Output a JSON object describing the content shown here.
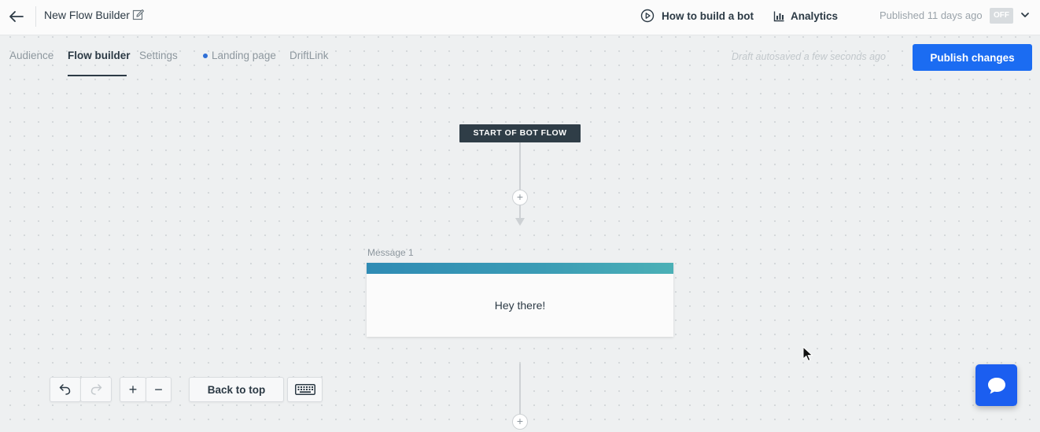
{
  "header": {
    "title": "New Flow Builder",
    "howto_label": "How to build a bot",
    "analytics_label": "Analytics",
    "published_text": "Published 11 days ago",
    "toggle_label": "OFF"
  },
  "tabs": [
    {
      "label": "Audience",
      "active": false
    },
    {
      "label": "Flow builder",
      "active": true
    },
    {
      "label": "Settings",
      "active": false
    },
    {
      "label": "Landing page",
      "active": false
    },
    {
      "label": "DriftLink",
      "active": false
    }
  ],
  "autosave_text": "Draft autosaved a few seconds ago",
  "publish_label": "Publish changes",
  "canvas": {
    "start_label": "START OF BOT FLOW",
    "add_symbol": "+",
    "message": {
      "label": "Message 1",
      "text": "Hey there!"
    }
  },
  "toolbar": {
    "zoom_in": "+",
    "zoom_out": "−",
    "back_to_top": "Back to top"
  },
  "colors": {
    "primary": "#1b6cf2",
    "chat_button": "#1b5ef0",
    "start_node": "#2f3d47",
    "message_bar": "#3a9bb5",
    "landing_dot": "#2f6fd6"
  },
  "icons": [
    "back-arrow-icon",
    "edit-icon",
    "play-circle-icon",
    "bar-chart-icon",
    "chevron-down-icon",
    "undo-icon",
    "redo-icon",
    "keyboard-icon",
    "chat-bubble-icon",
    "mouse-cursor-icon"
  ]
}
